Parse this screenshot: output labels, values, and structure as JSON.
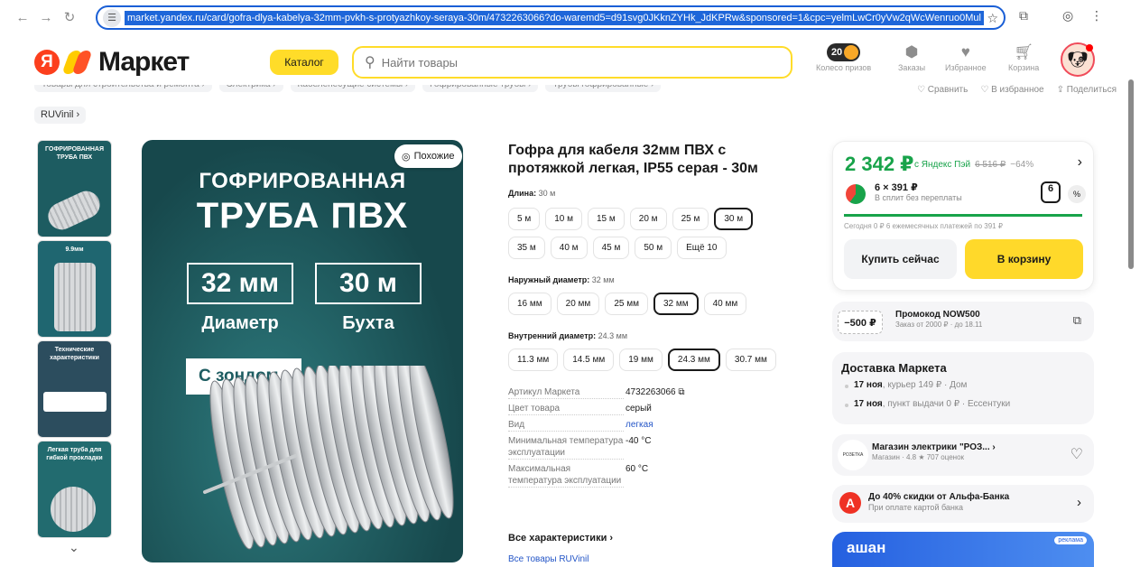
{
  "browser": {
    "url": "market.yandex.ru/card/gofra-dlya-kabelya-32mm-pvkh-s-protyazhkoy-seraya-30m/4732263066?do-waremd5=d91svg0JKknZYHk_JdKPRw&sponsored=1&cpc=yelmLwCr0yVw2qWcWenruo0Mul"
  },
  "header": {
    "logo_text": "Маркет",
    "catalog_label": "Каталог",
    "search_placeholder": "Найти товары",
    "coins": "20",
    "items": [
      {
        "label": "Колесо призов"
      },
      {
        "label": "Заказы"
      },
      {
        "label": "Избранное"
      },
      {
        "label": "Корзина"
      }
    ]
  },
  "breadcrumbs": {
    "items": [
      "Товары для строительства и ремонта ›",
      "Электрика ›",
      "Кабеленесущие системы ›",
      "Гофрированные трубы ›",
      "Трубы гофрированные ›"
    ],
    "right": [
      "♡ Сравнить",
      "♡ В избранное",
      "⇪ Поделиться"
    ],
    "last": "RUVinil ›"
  },
  "gallery": {
    "similar_label": "Похожие",
    "line1": "ГОФРИРОВАННАЯ",
    "line2": "ТРУБА ПВХ",
    "box1": "32 мм",
    "cap1": "Диаметр",
    "box2": "30 м",
    "cap2": "Бухта",
    "probe": "С зондом",
    "thumbs": [
      {
        "text": "ГОФРИРОВАННАЯ ТРУБА ПВХ"
      },
      {
        "text": "9.9мм"
      },
      {
        "text": "Технические характеристики"
      },
      {
        "text": "Легкая труба для гибкой прокладки"
      }
    ]
  },
  "product": {
    "title": "Гофра для кабеля 32мм ПВХ с протяжкой легкая, IP55 серая - 30м",
    "length_label": "Длина:",
    "length_value": "30 м",
    "lengths_row1": [
      {
        "label": "5 м",
        "selected": false
      },
      {
        "label": "10 м",
        "selected": false
      },
      {
        "label": "15 м",
        "selected": false
      },
      {
        "label": "20 м",
        "selected": false
      },
      {
        "label": "25 м",
        "selected": false
      },
      {
        "label": "30 м",
        "selected": true
      }
    ],
    "lengths_row2": [
      {
        "label": "35 м",
        "selected": false
      },
      {
        "label": "40 м",
        "selected": false
      },
      {
        "label": "45 м",
        "selected": false
      },
      {
        "label": "50 м",
        "selected": false
      },
      {
        "label": "Ещё 10",
        "selected": false
      }
    ],
    "outer_label": "Наружный диаметр:",
    "outer_value": "32 мм",
    "outer": [
      {
        "label": "16 мм",
        "selected": false
      },
      {
        "label": "20 мм",
        "selected": false
      },
      {
        "label": "25 мм",
        "selected": false
      },
      {
        "label": "32 мм",
        "selected": true
      },
      {
        "label": "40 мм",
        "selected": false
      }
    ],
    "inner_label": "Внутренний диаметр:",
    "inner_value": "24.3 мм",
    "inner": [
      {
        "label": "11.3 мм",
        "selected": false
      },
      {
        "label": "14.5 мм",
        "selected": false
      },
      {
        "label": "19 мм",
        "selected": false
      },
      {
        "label": "24.3 мм",
        "selected": true
      },
      {
        "label": "30.7 мм",
        "selected": false
      }
    ],
    "specs": [
      {
        "key": "Артикул Маркета",
        "value": "4732263066",
        "link": false
      },
      {
        "key": "Цвет товара",
        "value": "серый",
        "link": false
      },
      {
        "key": "Вид",
        "value": "легкая",
        "link": true
      },
      {
        "key": "Минимальная температура эксплуатации",
        "value": "-40 °C",
        "link": false
      },
      {
        "key": "Максимальная температура эксплуатации",
        "value": "60 °C",
        "link": false
      }
    ],
    "all_chars": "Все характеристики ›",
    "all_goods": "Все товары RUVinil"
  },
  "price": {
    "main": "2 342 ₽",
    "with_label": "с Яндекс Пэй",
    "old": "6 516 ₽",
    "discount": "−64%",
    "split_main": "6 × 391 ₽",
    "split_sub": "В сплит без переплаты",
    "split_count": "6",
    "split_info": "Сегодня 0 ₽  6 ежемесячных платежей по 391 ₽",
    "split_progress": 1,
    "buy_now": "Купить сейчас",
    "to_cart": "В корзину"
  },
  "promo": {
    "value": "−500 ₽",
    "title": "Промокод NOW500",
    "sub": "Заказ от 2000 ₽ · до 18.11"
  },
  "delivery": {
    "title": "Доставка Маркета",
    "rows": [
      {
        "date": "17 ноя",
        "text": ", курьер 149 ₽ · Дом"
      },
      {
        "date": "17 ноя",
        "text": ", пункт выдачи 0 ₽ · Ессентуки"
      }
    ]
  },
  "shop": {
    "logo": "РОЗЕТКА",
    "name": "Магазин электрики \"РОЗ... ›",
    "sub": "Магазин · 4.8 ★ 707 оценок"
  },
  "alfa": {
    "title": "До 40% скидки от Альфа-Банка",
    "sub": "При оплате картой банка"
  },
  "ad": {
    "brand": "ашан",
    "label": "реклама"
  },
  "colors": {
    "accent_yellow": "#ffdc29",
    "price_green": "#18a34a",
    "link_blue": "#2456c7",
    "image_teal": "#1d5c61"
  }
}
